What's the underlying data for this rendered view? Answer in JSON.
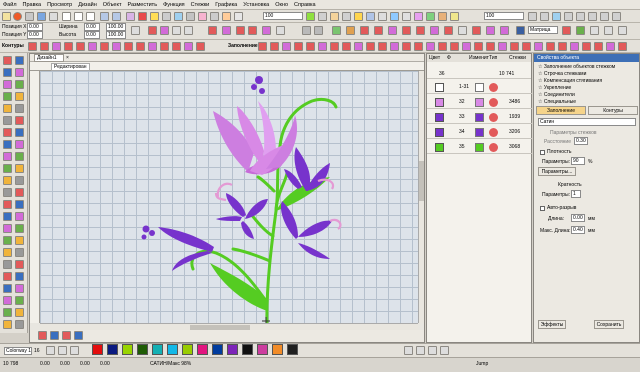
{
  "menu": [
    "Файл",
    "Правка",
    "Просмотр",
    "Дизайн",
    "Объект",
    "Разместить",
    "Функция",
    "Стежки",
    "Графика",
    "Установка",
    "Окно",
    "Справка"
  ],
  "toolbar": {
    "zoom1": "100",
    "zoom2": "100",
    "format_label": "Матрица",
    "pos_x_label": "Позиция X",
    "pos_x": "0.00",
    "pos_y_label": "Позиция Y",
    "pos_y": "0.00",
    "width_label": "Ширина",
    "width": "0.00",
    "height_label": "Высота",
    "height": "0.00",
    "w_pct": "100.00",
    "h_pct": "100.00",
    "contours_label": "Контуры",
    "fill_label": "Заполнение"
  },
  "document": {
    "tab": "Дизайн1",
    "ruler_label": "Редактирован"
  },
  "sequence": {
    "columns": [
      "Цвет",
      "Ф",
      "Изменит",
      "Тип",
      "Стежки"
    ],
    "rows": [
      {
        "num": "1-31",
        "stitches": "",
        "color": "#ffffff"
      },
      {
        "num": "32",
        "stitches": "3486",
        "color": "#d889e6"
      },
      {
        "num": "33",
        "stitches": "1939",
        "color": "#7733cc"
      },
      {
        "num": "34",
        "stitches": "3206",
        "color": "#7733cc"
      },
      {
        "num": "35",
        "stitches": "3068",
        "color": "#55cc22"
      }
    ],
    "header_num": "36",
    "header_total": "10 741"
  },
  "props": {
    "title": "Свойства объекта",
    "tree": [
      "Заполнение объектов стежком",
      "Строчка стежками",
      "Компенсация стягивания",
      "Укрепление",
      "Соединители",
      "Специальные"
    ],
    "tab_fill": "Заполнение",
    "tab_contour": "Контуры",
    "fill_type": "Сатин",
    "param_header": "Параметры стежков",
    "length_label": "Расстояние",
    "length_val": "0.30",
    "density_label": "Плотность",
    "params_label": "Параметры:",
    "params_val": "90",
    "params_unit": "%",
    "params_btn": "Параметры...",
    "mult_header": "Кратность",
    "mult_label": "Параметры:",
    "mult_val": "1",
    "auto_label": "Авто-разрыв",
    "min_label": "Длина:",
    "min_val": "0.00",
    "unit": "мм",
    "max_label": "Макс. Длина:",
    "max_val": "0.40",
    "effects_btn": "Эффекты",
    "save_btn": "Сохранить"
  },
  "bottom": {
    "palette_label": "Colorway 1",
    "color_count": "16",
    "status_stitches": "10 798",
    "status_x": "0.00",
    "status_y": "0.00",
    "status_l": "0.00",
    "status_a": "0.00",
    "status_type": "САТИН/Макс 98%",
    "status_command": "Jump"
  },
  "palette": [
    "#e30d0d",
    "#0b1a80",
    "#99d400",
    "#1f5c05",
    "#14b0b3",
    "#13b8e6",
    "#99cc00",
    "#e2157f",
    "#003c9e",
    "#7d24b8",
    "#111111",
    "#cc3d9e",
    "#f28c28",
    "#202020"
  ]
}
